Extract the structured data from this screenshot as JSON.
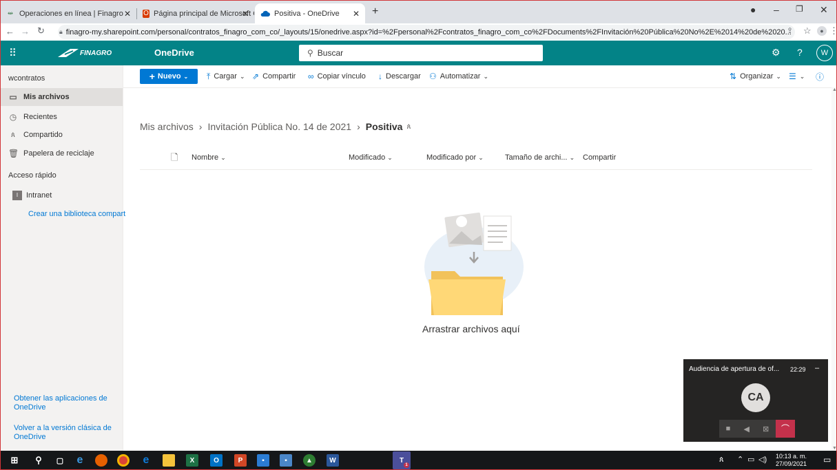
{
  "browser": {
    "tabs": [
      {
        "title": "Operaciones en línea | Finagro"
      },
      {
        "title": "Página principal de Microsoft Of"
      },
      {
        "title": "Positiva - OneDrive"
      }
    ],
    "new_tab": "+",
    "url": "finagro-my.sharepoint.com/personal/contratos_finagro_com_co/_layouts/15/onedrive.aspx?id=%2Fpersonal%2Fcontratos_finagro_com_co%2FDocuments%2FInvitación%20Pública%20No%2E%2014%20de%2020..."
  },
  "suite": {
    "brand": "FINAGRO",
    "app": "OneDrive",
    "search_placeholder": "Buscar",
    "avatar": "W"
  },
  "nav": {
    "owner": "wcontratos",
    "items": [
      {
        "label": "Mis archivos"
      },
      {
        "label": "Recientes"
      },
      {
        "label": "Compartido"
      },
      {
        "label": "Papelera de reciclaje"
      }
    ],
    "quick_access": "Acceso rápido",
    "intranet": "Intranet",
    "intranet_initial": "I",
    "create_library": "Crear una biblioteca compart",
    "get_apps": "Obtener las aplicaciones de OneDrive",
    "classic": "Volver a la versión clásica de OneDrive"
  },
  "commands": {
    "new": "Nuevo",
    "upload": "Cargar",
    "share": "Compartir",
    "copy_link": "Copiar vínculo",
    "download": "Descargar",
    "automate": "Automatizar",
    "organize": "Organizar"
  },
  "breadcrumb": [
    "Mis archivos",
    "Invitación Pública No. 14 de 2021",
    "Positiva"
  ],
  "columns": {
    "name": "Nombre",
    "modified": "Modificado",
    "modified_by": "Modificado por",
    "size": "Tamaño de archi...",
    "sharing": "Compartir"
  },
  "empty": {
    "message": "Arrastrar archivos aquí"
  },
  "call": {
    "title": "Audiencia de apertura de of...",
    "duration": "22:29",
    "initials": "CA"
  },
  "taskbar": {
    "time": "10:13 a. m.",
    "date": "27/09/2021",
    "teams_badge": "1"
  },
  "colors": {
    "suite": "#038387",
    "accent": "#0078d4",
    "hangup": "#c4314b"
  }
}
